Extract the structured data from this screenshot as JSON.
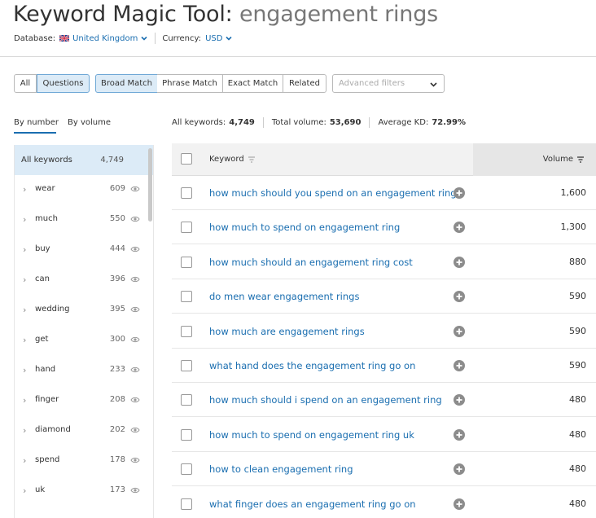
{
  "header": {
    "title_prefix": "Keyword Magic Tool:",
    "title_query": "engagement rings",
    "database_label": "Database:",
    "database_value": "United Kingdom",
    "currency_label": "Currency:",
    "currency_value": "USD"
  },
  "toolbar": {
    "all_label": "All",
    "questions_label": "Questions",
    "broad_label": "Broad Match",
    "phrase_label": "Phrase Match",
    "exact_label": "Exact Match",
    "related_label": "Related",
    "filters_placeholder": "Advanced filters"
  },
  "sort_tabs": {
    "by_number": "By number",
    "by_volume": "By volume"
  },
  "stats": {
    "all_keywords_label": "All keywords:",
    "all_keywords_value": "4,749",
    "total_volume_label": "Total volume:",
    "total_volume_value": "53,690",
    "avg_kd_label": "Average KD:",
    "avg_kd_value": "72.99%"
  },
  "sidebar": {
    "all": {
      "label": "All keywords",
      "count": "4,749"
    },
    "groups": [
      {
        "label": "wear",
        "count": "609"
      },
      {
        "label": "much",
        "count": "550"
      },
      {
        "label": "buy",
        "count": "444"
      },
      {
        "label": "can",
        "count": "396"
      },
      {
        "label": "wedding",
        "count": "395"
      },
      {
        "label": "get",
        "count": "300"
      },
      {
        "label": "hand",
        "count": "233"
      },
      {
        "label": "finger",
        "count": "208"
      },
      {
        "label": "diamond",
        "count": "202"
      },
      {
        "label": "spend",
        "count": "178"
      },
      {
        "label": "uk",
        "count": "173"
      }
    ]
  },
  "table": {
    "col_keyword": "Keyword",
    "col_volume": "Volume",
    "rows": [
      {
        "keyword": "how much should you spend on an engagement ring",
        "volume": "1,600"
      },
      {
        "keyword": "how much to spend on engagement ring",
        "volume": "1,300"
      },
      {
        "keyword": "how much should an engagement ring cost",
        "volume": "880"
      },
      {
        "keyword": "do men wear engagement rings",
        "volume": "590"
      },
      {
        "keyword": "how much are engagement rings",
        "volume": "590"
      },
      {
        "keyword": "what hand does the engagement ring go on",
        "volume": "590"
      },
      {
        "keyword": "how much should i spend on an engagement ring",
        "volume": "480"
      },
      {
        "keyword": "how much to spend on engagement ring uk",
        "volume": "480"
      },
      {
        "keyword": "how to clean engagement ring",
        "volume": "480"
      },
      {
        "keyword": "what finger does an engagement ring go on",
        "volume": "480"
      }
    ]
  },
  "colors": {
    "link": "#1a6eb0",
    "selected_bg": "#dcebf7"
  }
}
